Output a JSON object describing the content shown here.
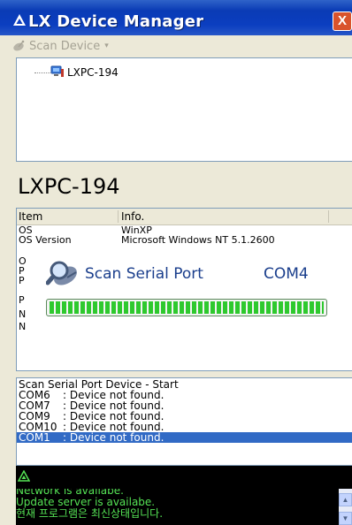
{
  "window": {
    "title": "LX Device Manager",
    "close_glyph": "X",
    "icon": "lx-logo-icon"
  },
  "toolbar": {
    "scan_device_label": "Scan Device",
    "dropdown_glyph": "▾"
  },
  "tree": {
    "node_label": "LXPC-194"
  },
  "device": {
    "title": "LXPC-194"
  },
  "info": {
    "columns": [
      "Item",
      "Info."
    ],
    "rows": [
      {
        "item": "OS",
        "info": "WinXP"
      },
      {
        "item": "OS Version",
        "info": "Microsoft Windows NT 5.1.2600"
      },
      {
        "item": "O",
        "info": ""
      },
      {
        "item": "P",
        "info": ""
      },
      {
        "item": "P",
        "info": ""
      },
      {
        "item": "P",
        "info": ""
      },
      {
        "item": "N",
        "info": ""
      },
      {
        "item": "N",
        "info": ""
      }
    ]
  },
  "scan_dialog": {
    "label": "Scan Serial Port",
    "port": "COM4",
    "progress": 1.0
  },
  "log": {
    "header": "Scan Serial Port Device - Start",
    "entries": [
      {
        "port": "COM6",
        "msg": ": Device not found."
      },
      {
        "port": "COM7",
        "msg": ": Device not found."
      },
      {
        "port": "COM9",
        "msg": ": Device not found."
      },
      {
        "port": "COM10",
        "msg": ": Device not found."
      },
      {
        "port": "COM1",
        "msg": ": Device not found."
      }
    ]
  },
  "status": {
    "lines": [
      "Network is availabe.",
      "Update server is availabe.",
      "현재 프로그램은 최신상태입니다."
    ]
  },
  "colors": {
    "titlebar": "#0b3ec0",
    "selection": "#316ac5",
    "status_text": "#55e255",
    "progress": "#2ec92e",
    "scan_text": "#1a3e8c"
  }
}
